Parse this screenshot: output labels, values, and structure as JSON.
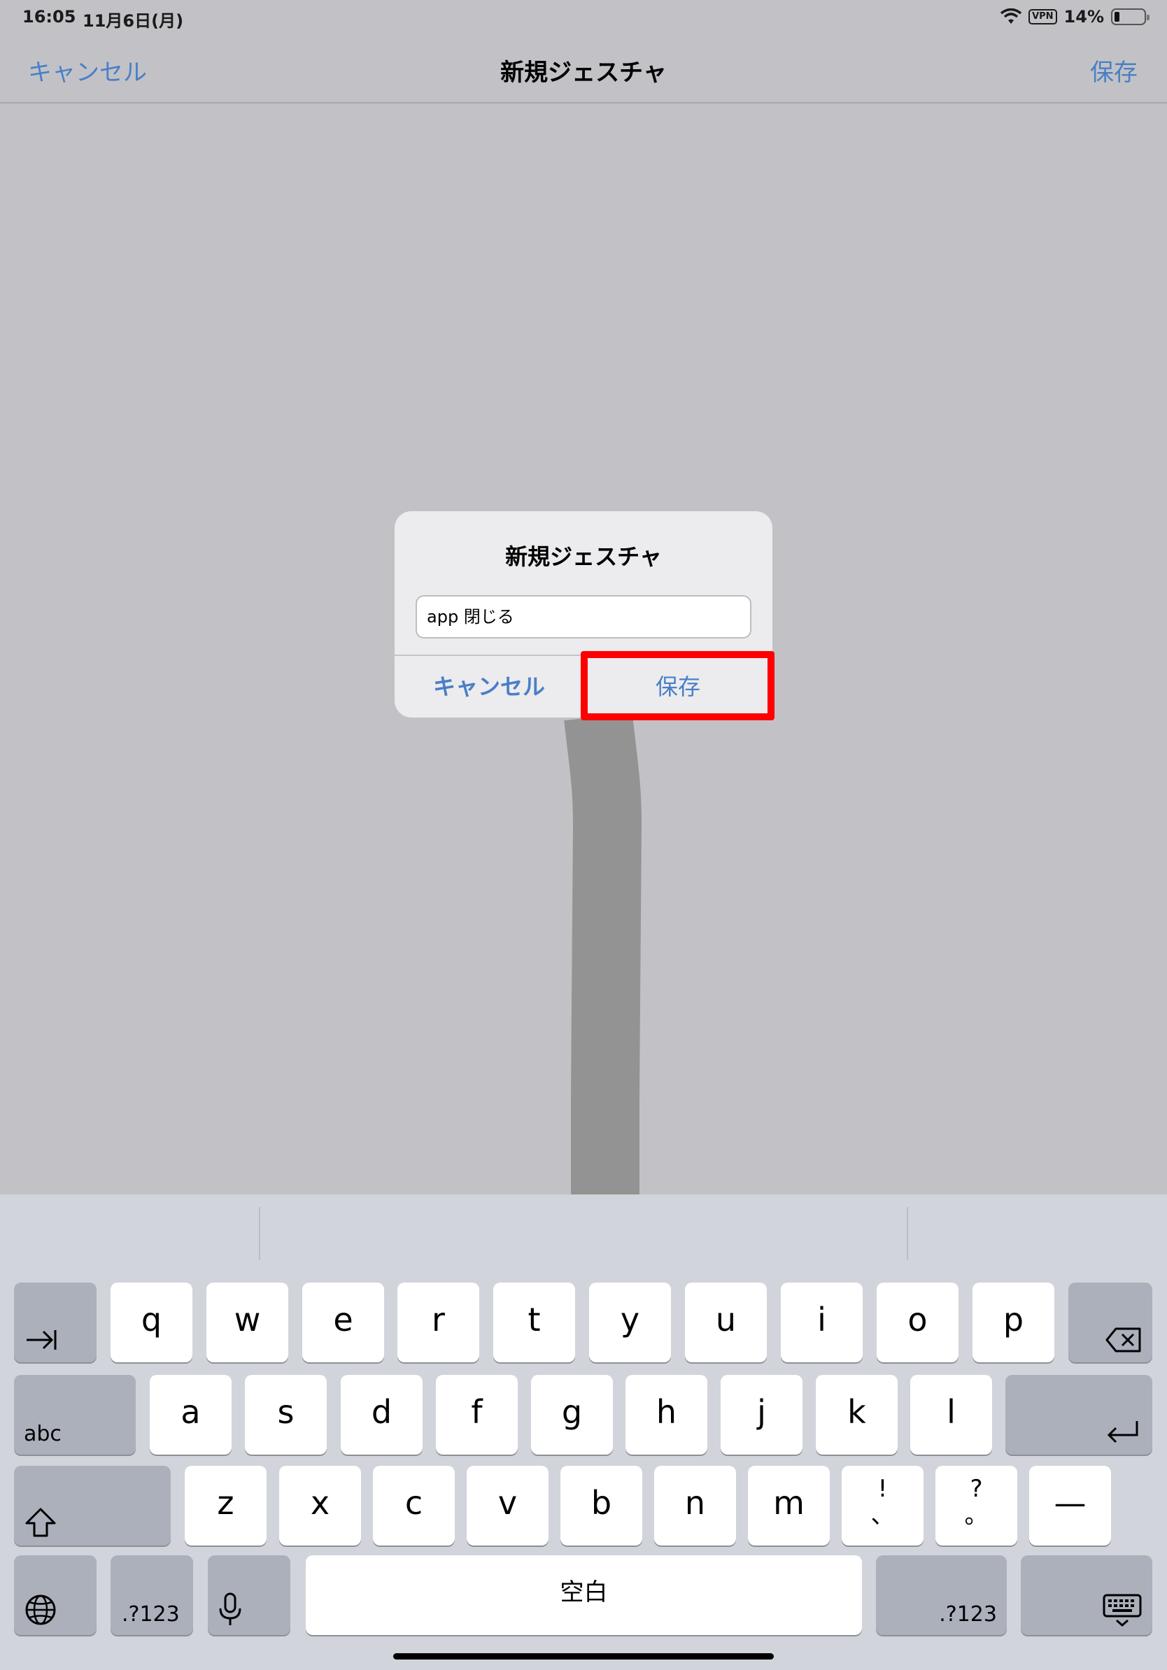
{
  "status_bar": {
    "time": "16:05",
    "date": "11月6日(月)",
    "vpn": "VPN",
    "battery": "14%"
  },
  "nav": {
    "cancel": "キャンセル",
    "title": "新規ジェスチャ",
    "save": "保存"
  },
  "alert": {
    "title": "新規ジェスチャ",
    "input_value": "app 閉じる",
    "cancel": "キャンセル",
    "save": "保存"
  },
  "keyboard": {
    "row1": [
      "q",
      "w",
      "e",
      "r",
      "t",
      "y",
      "u",
      "i",
      "o",
      "p"
    ],
    "row2": [
      "a",
      "s",
      "d",
      "f",
      "g",
      "h",
      "j",
      "k",
      "l"
    ],
    "row3": [
      "z",
      "x",
      "c",
      "v",
      "b",
      "n",
      "m"
    ],
    "abc": "abc",
    "exclam_top": "!",
    "exclam_bottom": "、",
    "question_top": "?",
    "question_bottom": "。",
    "dash": "—",
    "num_left": ".?123",
    "space": "空白",
    "num_right": ".?123",
    "icons": [
      "tab-icon",
      "delete-icon",
      "return-icon",
      "shift-icon",
      "globe-icon",
      "microphone-icon",
      "hide-keyboard-icon"
    ]
  },
  "colors": {
    "accent": "#4a7fc6",
    "highlight": "#ff0000",
    "stroke": "#939393"
  }
}
